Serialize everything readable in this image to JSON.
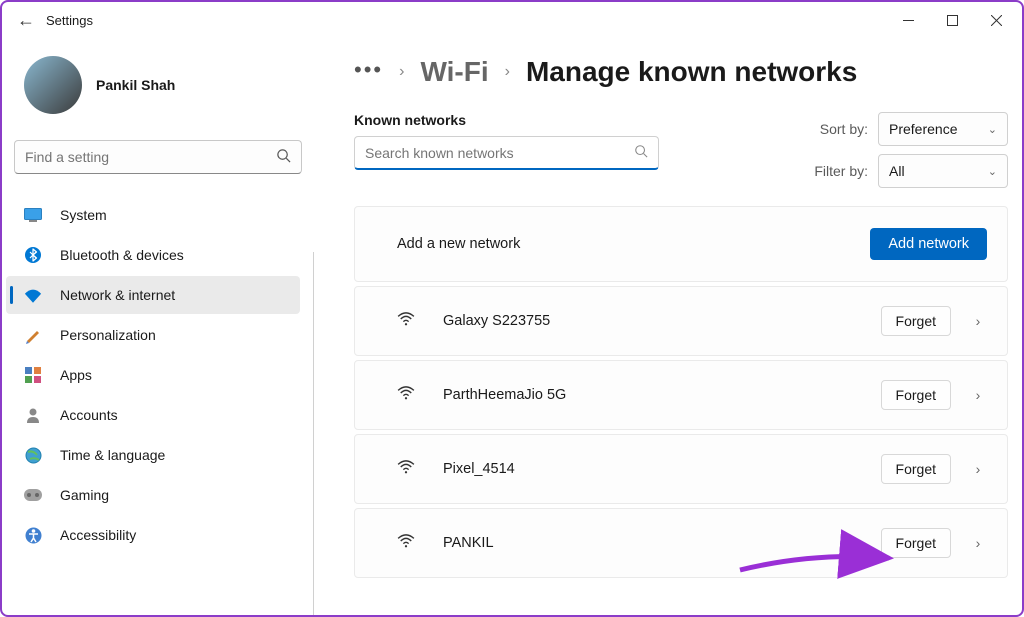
{
  "window": {
    "title": "Settings"
  },
  "profile": {
    "name": "Pankil Shah"
  },
  "search": {
    "placeholder": "Find a setting"
  },
  "sidebar": {
    "items": [
      {
        "label": "System"
      },
      {
        "label": "Bluetooth & devices"
      },
      {
        "label": "Network & internet"
      },
      {
        "label": "Personalization"
      },
      {
        "label": "Apps"
      },
      {
        "label": "Accounts"
      },
      {
        "label": "Time & language"
      },
      {
        "label": "Gaming"
      },
      {
        "label": "Accessibility"
      }
    ]
  },
  "breadcrumb": {
    "parent": "Wi-Fi",
    "current": "Manage known networks"
  },
  "known": {
    "section_label": "Known networks",
    "search_placeholder": "Search known networks"
  },
  "filters": {
    "sort_label": "Sort by:",
    "sort_value": "Preference",
    "filter_label": "Filter by:",
    "filter_value": "All"
  },
  "add_row": {
    "label": "Add a new network",
    "button": "Add network"
  },
  "networks": [
    {
      "name": "Galaxy S223755",
      "action": "Forget"
    },
    {
      "name": "ParthHeemaJio 5G",
      "action": "Forget"
    },
    {
      "name": "Pixel_4514",
      "action": "Forget"
    },
    {
      "name": "PANKIL",
      "action": "Forget"
    }
  ]
}
